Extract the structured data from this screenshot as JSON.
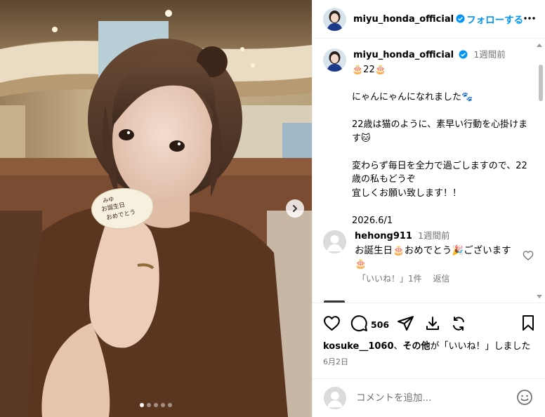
{
  "post": {
    "username": "miyu_honda_official",
    "follow_label": "フォローする",
    "more_icon": "ellipsis-icon",
    "time_ago": "1週間前",
    "caption_prefix": "🎂22🎂",
    "caption_body": "にゃんにゃんになれました🐾\n\n22歳は猫のように、素早い行動を心掛けます🐱\n\n変わらず毎日を全力で過ごしますので、22歳の私もどうぞ\n宜しくお願い致します！！\n\n2026.6/1",
    "carousel": {
      "current": 1,
      "total": 5
    }
  },
  "photo": {
    "card_text_line1": "みゆ",
    "card_text_line2": "お誕生日",
    "card_text_line3": "おめでとう"
  },
  "comment": {
    "username": "hehong911",
    "time_ago": "1週間前",
    "text": "お誕生日🎂おめでとう🎉ございます🎂",
    "likes_label": "「いいね！」1件",
    "reply_label": "返信"
  },
  "actions": {
    "comment_count": "506",
    "liked_by_user": "kosuke__1060",
    "liked_by_suffix": "、",
    "liked_by_others": "その他",
    "liked_by_tail": "が「いいね！」しました",
    "date": "6月2日"
  },
  "add_comment": {
    "placeholder": "コメントを追加..."
  },
  "colors": {
    "accent": "#0095f6",
    "muted": "#737373",
    "divider": "#efefef"
  }
}
